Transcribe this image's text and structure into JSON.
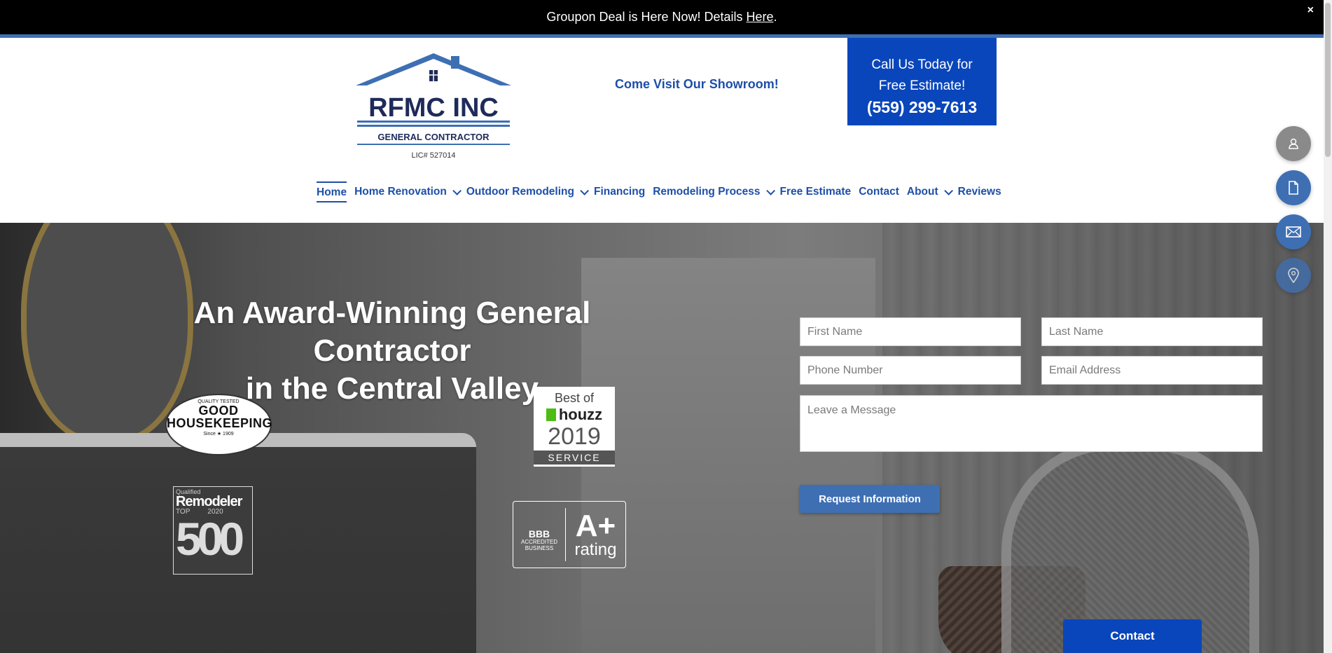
{
  "announcement": {
    "text": "Groupon Deal is Here Now! Details ",
    "link_label": "Here",
    "suffix": ".",
    "close_glyph": "×"
  },
  "logo": {
    "company": "RFMC INC",
    "subtitle": "GENERAL CONTRACTOR",
    "license": "LIC# 527014"
  },
  "header": {
    "showroom_link": "Come Visit Our Showroom!",
    "call_line1": "Call Us Today for",
    "call_line2": "Free Estimate!",
    "phone": "(559) 299-7613"
  },
  "nav": {
    "items": [
      {
        "label": "Home",
        "active": true,
        "dropdown": false
      },
      {
        "label": "Home Renovation",
        "dropdown": true
      },
      {
        "label": "Outdoor Remodeling",
        "dropdown": true
      },
      {
        "label": "Financing",
        "dropdown": false
      },
      {
        "label": "Remodeling Process",
        "dropdown": true
      },
      {
        "label": "Free Estimate",
        "dropdown": false
      },
      {
        "label": "Contact",
        "dropdown": false
      },
      {
        "label": "About",
        "dropdown": true
      },
      {
        "label": "Reviews",
        "dropdown": false
      }
    ]
  },
  "hero": {
    "headline_line1": "An Award-Winning General Contractor",
    "headline_line2": "in the Central Valley",
    "badges": {
      "good_housekeeping": {
        "top": "QUALITY TESTED",
        "line1": "GOOD",
        "line2": "HOUSEKEEPING",
        "bottom": "Since ★ 1909"
      },
      "houzz": {
        "line1": "Best of",
        "brand": "houzz",
        "year": "2019",
        "category": "SERVICE"
      },
      "remodeler": {
        "qualified": "Qualified",
        "name": "Remodeler",
        "top": "TOP",
        "year": "2020",
        "number": "500"
      },
      "bbb": {
        "name": "BBB",
        "accredited": "ACCREDITED",
        "business": "BUSINESS",
        "grade": "A+",
        "rating": "rating"
      }
    }
  },
  "form": {
    "first_name_placeholder": "First Name",
    "last_name_placeholder": "Last Name",
    "phone_placeholder": "Phone Number",
    "email_placeholder": "Email Address",
    "message_placeholder": "Leave a Message",
    "submit_label": "Request Information"
  },
  "side_buttons": [
    {
      "icon": "user-icon",
      "color": "#8a8a8a"
    },
    {
      "icon": "document-icon",
      "color": "#3e6fb3"
    },
    {
      "icon": "mail-icon",
      "color": "#3e6fb3"
    },
    {
      "icon": "map-pin-icon",
      "color": "#3e6fb3"
    }
  ],
  "contact_tab": {
    "label": "Contact"
  },
  "colors": {
    "brand_blue": "#1d4fa8",
    "cta_blue": "#0a46bb",
    "accent": "#3e6fb3"
  }
}
